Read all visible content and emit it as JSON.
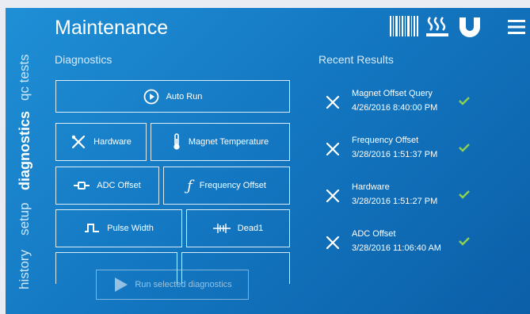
{
  "header": {
    "title": "Maintenance"
  },
  "sidebar": {
    "tabs": [
      {
        "label": "qc tests",
        "active": false
      },
      {
        "label": "diagnostics",
        "active": true
      },
      {
        "label": "setup",
        "active": false
      },
      {
        "label": "history",
        "active": false
      }
    ]
  },
  "diagnostics": {
    "heading": "Diagnostics",
    "auto_run": "Auto Run",
    "hardware": "Hardware",
    "magnet_temperature": "Magnet Temperature",
    "adc_offset": "ADC Offset",
    "frequency_offset": "Frequency Offset",
    "pulse_width": "Pulse Width",
    "dead1": "Dead1",
    "run_selected": "Run selected diagnostics"
  },
  "recent": {
    "heading": "Recent Results",
    "items": [
      {
        "name": "Magnet Offset Query",
        "date": "4/26/2016 8:40:00 PM"
      },
      {
        "name": "Frequency Offset",
        "date": "3/28/2016 1:51:37 PM"
      },
      {
        "name": "Hardware",
        "date": "3/28/2016 1:51:27 PM"
      },
      {
        "name": "ADC Offset",
        "date": "3/28/2016 11:06:40 AM"
      }
    ]
  },
  "colors": {
    "background": "#1478c2",
    "check": "#8fd14f"
  },
  "icons": [
    "barcode-icon",
    "heat-icon",
    "magnet-icon",
    "menu-icon"
  ]
}
